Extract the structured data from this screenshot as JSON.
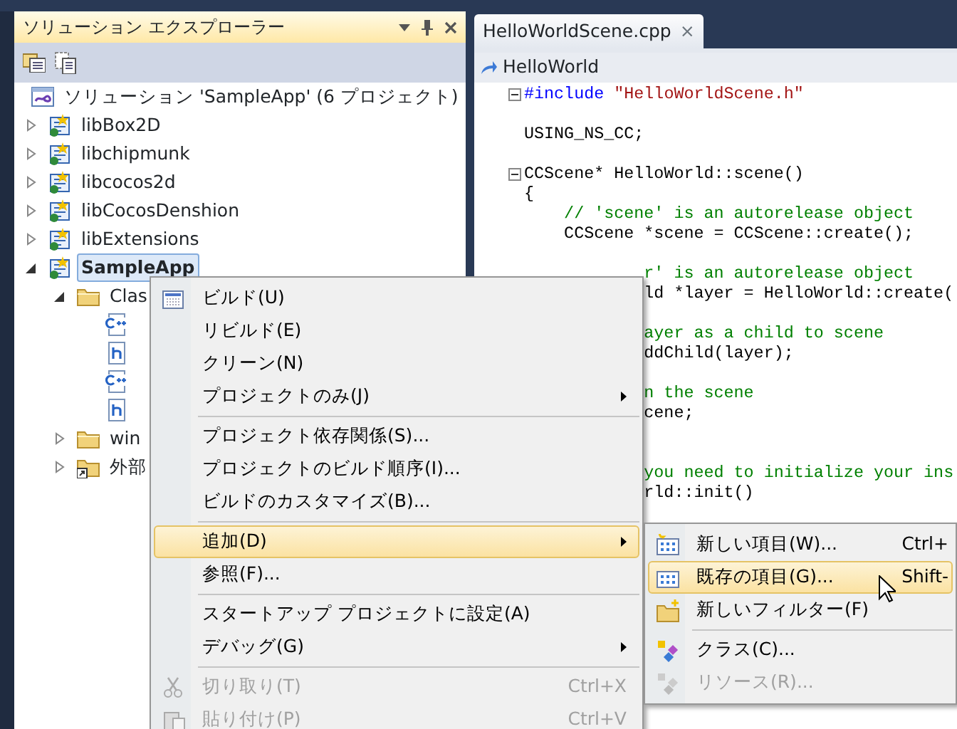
{
  "solution_explorer": {
    "title": "ソリューション エクスプローラー",
    "tree": [
      {
        "kind": "solution",
        "label": "ソリューション 'SampleApp' (6 プロジェクト)",
        "selected": false
      },
      {
        "kind": "project",
        "label": "libBox2D",
        "expanded": false,
        "selected": false
      },
      {
        "kind": "project",
        "label": "libchipmunk",
        "expanded": false,
        "selected": false
      },
      {
        "kind": "project",
        "label": "libcocos2d",
        "expanded": false,
        "selected": false
      },
      {
        "kind": "project",
        "label": "libCocosDenshion",
        "expanded": false,
        "selected": false
      },
      {
        "kind": "project",
        "label": "libExtensions",
        "expanded": false,
        "selected": false
      },
      {
        "kind": "project",
        "label": "SampleApp",
        "expanded": true,
        "selected": true,
        "children": [
          {
            "kind": "folder",
            "label": "Clas",
            "expanded": true,
            "selected": false,
            "children": [
              {
                "kind": "cpp",
                "selected": false
              },
              {
                "kind": "header",
                "selected": false
              },
              {
                "kind": "cpp",
                "selected": false
              },
              {
                "kind": "header",
                "selected": false
              }
            ]
          },
          {
            "kind": "folder",
            "label": "win",
            "expanded": false,
            "selected": false
          },
          {
            "kind": "external",
            "label": "外部",
            "expanded": false,
            "selected": false
          }
        ]
      }
    ]
  },
  "editor": {
    "tabs": [
      {
        "label": "HelloWorldScene.cpp",
        "close": "×",
        "selected": true
      }
    ],
    "navigation": "HelloWorld",
    "lines": [
      {
        "kind": "full",
        "fold": true,
        "segments": [
          {
            "kind": "keyword",
            "text": "#include"
          },
          {
            "kind": "string",
            "text": " \"HelloWorldScene.h\""
          }
        ]
      },
      {
        "kind": "blank"
      },
      {
        "kind": "full",
        "segments": [
          {
            "kind": "plain",
            "text": "USING_NS_CC;"
          }
        ]
      },
      {
        "kind": "blank"
      },
      {
        "kind": "full",
        "fold": true,
        "segments": [
          {
            "kind": "plain",
            "text": "CCScene* HelloWorld::scene()"
          }
        ]
      },
      {
        "kind": "full",
        "segments": [
          {
            "kind": "plain",
            "text": "{"
          }
        ]
      },
      {
        "kind": "full",
        "segments": [
          {
            "kind": "comment",
            "text": "    // 'scene' is an autorelease object"
          }
        ]
      },
      {
        "kind": "full",
        "segments": [
          {
            "kind": "plain",
            "text": "    CCScene *scene = CCScene::create();"
          }
        ]
      },
      {
        "kind": "blank"
      },
      {
        "kind": "clipped",
        "segments": [
          {
            "kind": "comment",
            "text": "r' is an autorelease object"
          }
        ]
      },
      {
        "kind": "clipped",
        "segments": [
          {
            "kind": "plain",
            "text": "ld *layer = HelloWorld::create("
          }
        ]
      },
      {
        "kind": "blank"
      },
      {
        "kind": "clipped",
        "segments": [
          {
            "kind": "comment",
            "text": "ayer as a child to scene"
          }
        ]
      },
      {
        "kind": "clipped",
        "segments": [
          {
            "kind": "plain",
            "text": "ddChild(layer);"
          }
        ]
      },
      {
        "kind": "blank"
      },
      {
        "kind": "clipped",
        "segments": [
          {
            "kind": "comment",
            "text": "n the scene"
          }
        ]
      },
      {
        "kind": "clipped",
        "segments": [
          {
            "kind": "plain",
            "text": "cene;"
          }
        ]
      },
      {
        "kind": "blank"
      },
      {
        "kind": "blank"
      },
      {
        "kind": "clipped",
        "segments": [
          {
            "kind": "comment",
            "text": "you need to initialize your ins"
          }
        ]
      },
      {
        "kind": "clipped",
        "segments": [
          {
            "kind": "plain",
            "text": "rld::init()"
          }
        ]
      }
    ]
  },
  "context_menu": {
    "items": [
      {
        "kind": "item",
        "label": "ビルド(U)",
        "submenu": false,
        "disabled": false,
        "highlighted": false
      },
      {
        "kind": "item",
        "label": "リビルド(E)",
        "submenu": false,
        "disabled": false,
        "highlighted": false
      },
      {
        "kind": "item",
        "label": "クリーン(N)",
        "submenu": false,
        "disabled": false,
        "highlighted": false
      },
      {
        "kind": "item",
        "label": "プロジェクトのみ(J)",
        "submenu": true,
        "disabled": false,
        "highlighted": false
      },
      {
        "kind": "separator"
      },
      {
        "kind": "item",
        "label": "プロジェクト依存関係(S)...",
        "submenu": false,
        "disabled": false,
        "highlighted": false
      },
      {
        "kind": "item",
        "label": "プロジェクトのビルド順序(I)...",
        "submenu": false,
        "disabled": false,
        "highlighted": false
      },
      {
        "kind": "item",
        "label": "ビルドのカスタマイズ(B)...",
        "submenu": false,
        "disabled": false,
        "highlighted": false
      },
      {
        "kind": "separator"
      },
      {
        "kind": "item",
        "label": "追加(D)",
        "submenu": true,
        "disabled": false,
        "highlighted": true
      },
      {
        "kind": "item",
        "label": "参照(F)...",
        "submenu": false,
        "disabled": false,
        "highlighted": false
      },
      {
        "kind": "separator"
      },
      {
        "kind": "item",
        "label": "スタートアップ プロジェクトに設定(A)",
        "submenu": false,
        "disabled": false,
        "highlighted": false
      },
      {
        "kind": "item",
        "label": "デバッグ(G)",
        "submenu": true,
        "disabled": false,
        "highlighted": false
      },
      {
        "kind": "separator"
      },
      {
        "kind": "item",
        "label": "切り取り(T)",
        "shortcut": "Ctrl+X",
        "submenu": false,
        "disabled": true,
        "highlighted": false
      },
      {
        "kind": "item",
        "label": "貼り付け(P)",
        "shortcut": "Ctrl+V",
        "submenu": false,
        "disabled": true,
        "highlighted": false
      }
    ]
  },
  "submenu": {
    "items": [
      {
        "kind": "item",
        "label": "新しい項目(W)...",
        "shortcut": "Ctrl+",
        "disabled": false,
        "highlighted": false
      },
      {
        "kind": "item",
        "label": "既存の項目(G)...",
        "shortcut": "Shift-",
        "disabled": false,
        "highlighted": true
      },
      {
        "kind": "item",
        "label": "新しいフィルター(F)",
        "disabled": false,
        "highlighted": false
      },
      {
        "kind": "separator"
      },
      {
        "kind": "item",
        "label": "クラス(C)...",
        "disabled": false,
        "highlighted": false
      },
      {
        "kind": "item",
        "label": "リソース(R)...",
        "disabled": true,
        "highlighted": false
      }
    ]
  }
}
